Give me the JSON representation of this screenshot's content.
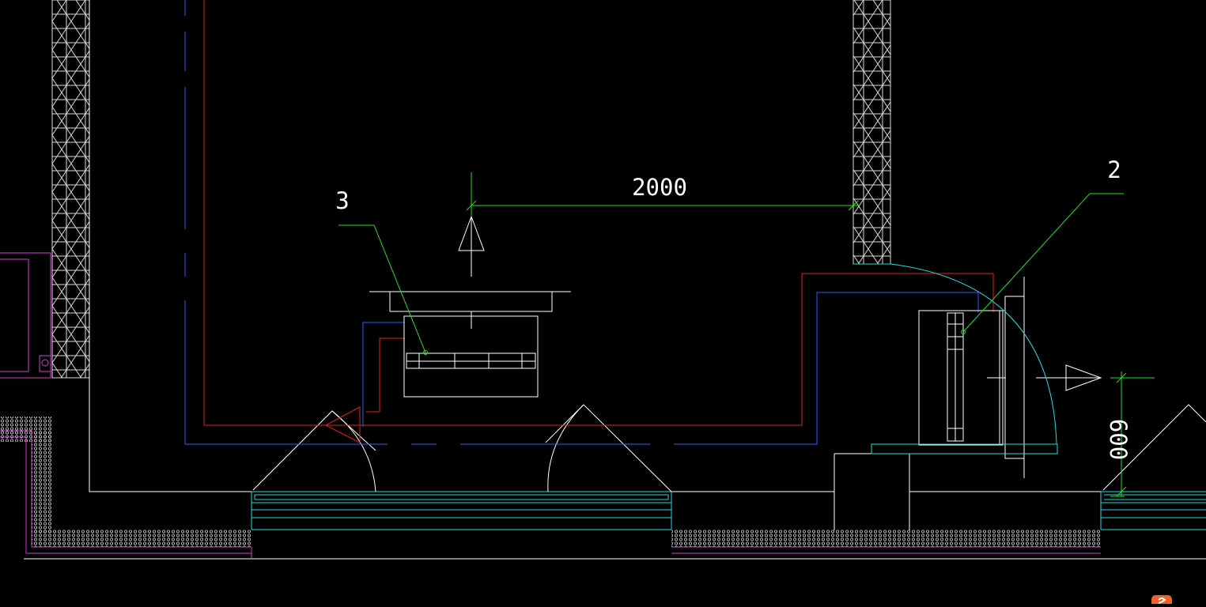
{
  "drawing": {
    "background": "#000000",
    "colors": {
      "white": "#ffffff",
      "red": "#e02020",
      "blue": "#2f5cff",
      "green": "#19e619",
      "cyan": "#24d8e0",
      "magenta": "#d23cd2"
    },
    "labels": {
      "dim_horizontal": "2000",
      "dim_vertical": "600",
      "leader_3": "3",
      "leader_2": "2"
    }
  },
  "app": {
    "logo_icon": "sogou-s-icon"
  }
}
